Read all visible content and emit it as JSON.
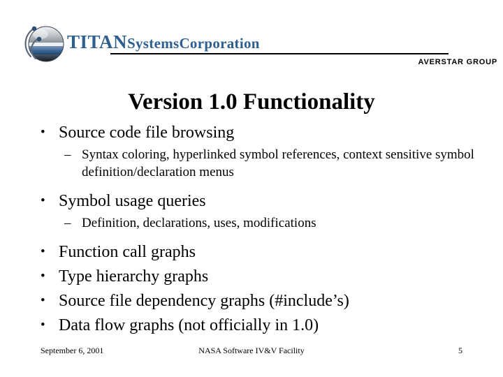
{
  "header": {
    "logo": {
      "icon_name": "titan-globe-logo",
      "wordmark_titan": "TITAN",
      "wordmark_systems": "Systems",
      "wordmark_corporation": "Corporation",
      "brand_color": "#2d5f91"
    },
    "subtitle": "AVERSTAR GROUP"
  },
  "title": "Version 1.0 Functionality",
  "body": {
    "items": [
      {
        "level": 1,
        "marker": "•",
        "text": "Source code file browsing"
      },
      {
        "level": 2,
        "marker": "–",
        "text": "Syntax coloring, hyperlinked symbol references, context sensitive symbol definition/declaration menus"
      },
      {
        "level": 1,
        "marker": "•",
        "text": "Symbol usage queries"
      },
      {
        "level": 2,
        "marker": "–",
        "text": "Definition, declarations, uses, modifications"
      },
      {
        "level": 1,
        "marker": "•",
        "text": "Function call graphs"
      },
      {
        "level": 1,
        "marker": "•",
        "text": "Type hierarchy graphs"
      },
      {
        "level": 1,
        "marker": "•",
        "text": "Source file dependency graphs (#include’s)"
      },
      {
        "level": 1,
        "marker": "•",
        "text": "Data flow graphs (not officially in 1.0)"
      }
    ]
  },
  "footer": {
    "date": "September 6, 2001",
    "center": "NASA Software IV&V Facility",
    "page": "5"
  }
}
